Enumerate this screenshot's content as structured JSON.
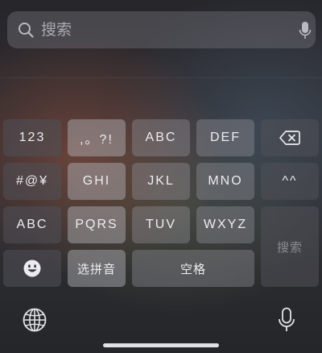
{
  "search": {
    "placeholder": "搜索"
  },
  "keyboard": {
    "row1": {
      "numbers": "123",
      "punct": ",。?!",
      "abc": "ABC",
      "def": "DEF"
    },
    "row2": {
      "symbols": "#@¥",
      "ghi": "GHI",
      "jkl": "JKL",
      "mno": "MNO",
      "emoticon": "^^"
    },
    "row3": {
      "abc_mode": "ABC",
      "pqrs": "PQRS",
      "tuv": "TUV",
      "wxyz": "WXYZ"
    },
    "row4": {
      "pinyin": "选拼音",
      "space": "空格"
    },
    "search_key": "搜索"
  }
}
